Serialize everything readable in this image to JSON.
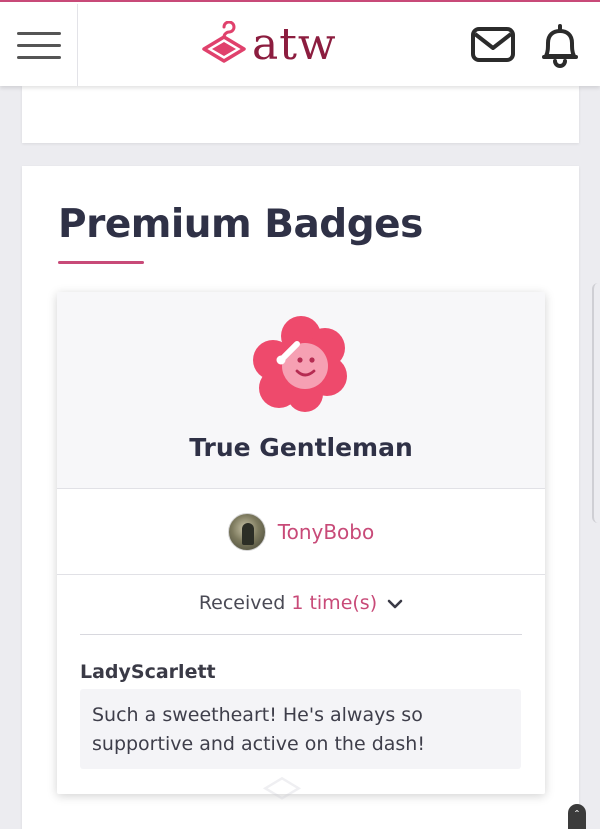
{
  "header": {
    "logo_text": "atw",
    "icons": {
      "menu": "hamburger-icon",
      "mail": "mail-icon",
      "notifications": "bell-icon",
      "logo": "hanger-logo-icon"
    }
  },
  "section": {
    "title": "Premium Badges"
  },
  "badge": {
    "name": "True Gentleman",
    "icon": "flower-face-badge-icon",
    "giver": "TonyBobo",
    "received_label": "Received",
    "received_count": "1 time(s)",
    "comments": [
      {
        "author": "LadyScarlett",
        "text": "Such a sweetheart! He's always so supportive and active on the dash!"
      }
    ]
  },
  "colors": {
    "accent": "#c84a78",
    "logo_dark": "#8c1d3f",
    "badge_pink": "#ee4a6c",
    "text_dark": "#2f3146",
    "background": "#ececf0"
  }
}
